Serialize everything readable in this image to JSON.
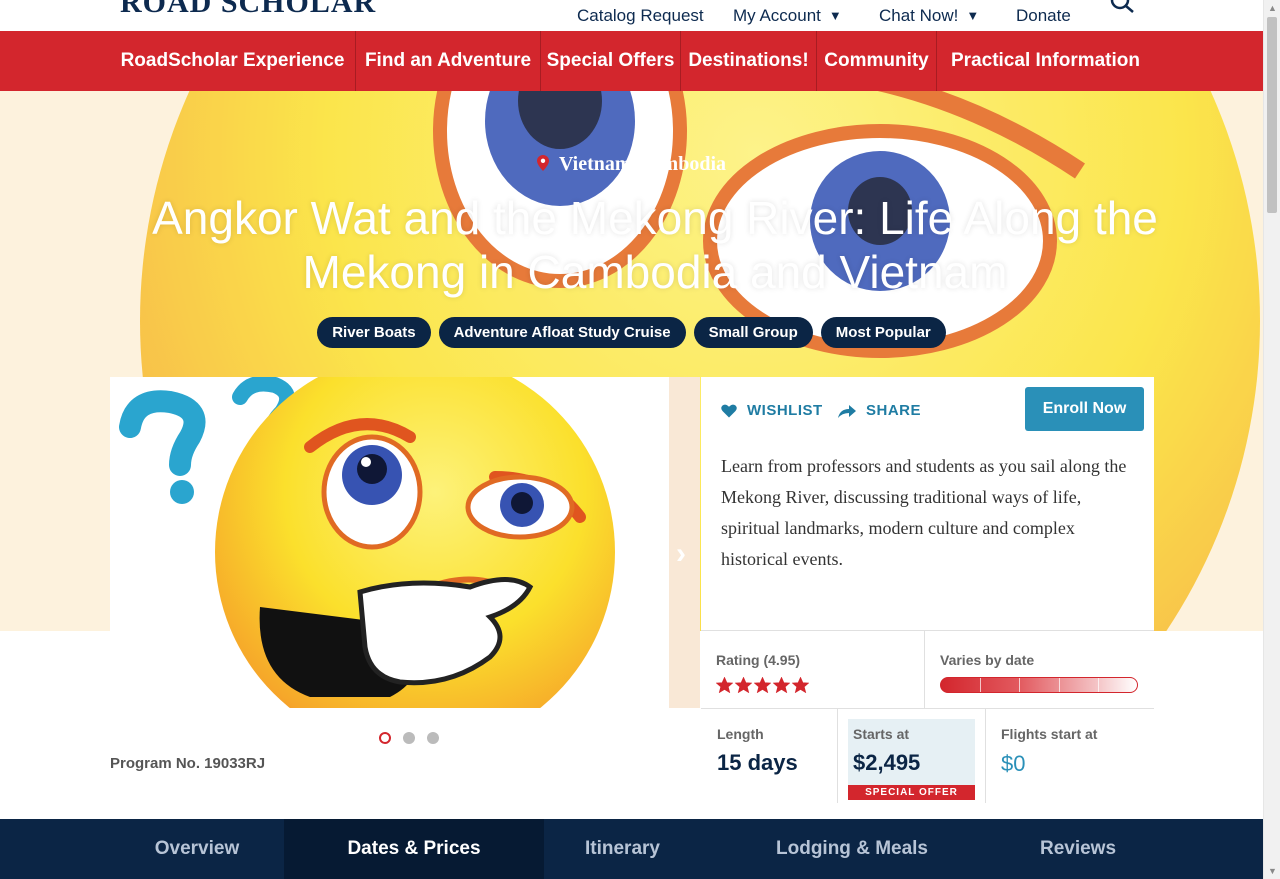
{
  "brand": {
    "logo": "ROAD SCHOLAR"
  },
  "utility_nav": {
    "catalog": "Catalog Request",
    "account": "My Account",
    "chat": "Chat Now!",
    "donate": "Donate"
  },
  "main_nav": [
    "RoadScholar Experience",
    "Find an Adventure",
    "Special Offers",
    "Destinations!",
    "Community",
    "Practical Information"
  ],
  "hero": {
    "location": "Vietnam/Cambodia",
    "title": "Angkor Wat and the Mekong River: Life Along the Mekong in Cambodia and Vietnam",
    "tags": [
      "River Boats",
      "Adventure Afloat Study Cruise",
      "Small Group",
      "Most Popular"
    ]
  },
  "program": {
    "wishlist": "WISHLIST",
    "share": "SHARE",
    "enroll": "Enroll Now",
    "description": "Learn from professors and students as you sail along the Mekong River, discussing traditional ways of life, spiritual landmarks, modern culture and complex historical events.",
    "rating_label": "Rating (4.95)",
    "rating": 4.95,
    "rating_max": 5,
    "activity_label": "Varies by date",
    "length_label": "Length",
    "length_value": "15 days",
    "starts_label": "Starts at",
    "starts_value": "$2,495",
    "special_offer": "SPECIAL OFFER",
    "flights_label": "Flights start at",
    "flights_value": "$0",
    "program_no": "Program No. 19033RJ",
    "gallery_slides": 3,
    "gallery_active": 0
  },
  "tabs": [
    "Overview",
    "Dates & Prices",
    "Itinerary",
    "Lodging & Meals",
    "Reviews"
  ],
  "tabs_active": 1,
  "colors": {
    "brand_red": "#d3262d",
    "navy": "#0b2545",
    "accent_blue": "#2a90b8"
  },
  "icons": [
    "search-icon",
    "chevron-down-icon",
    "map-pin-icon",
    "heart-icon",
    "share-arrow-icon",
    "star-icon",
    "chevron-right-icon"
  ]
}
